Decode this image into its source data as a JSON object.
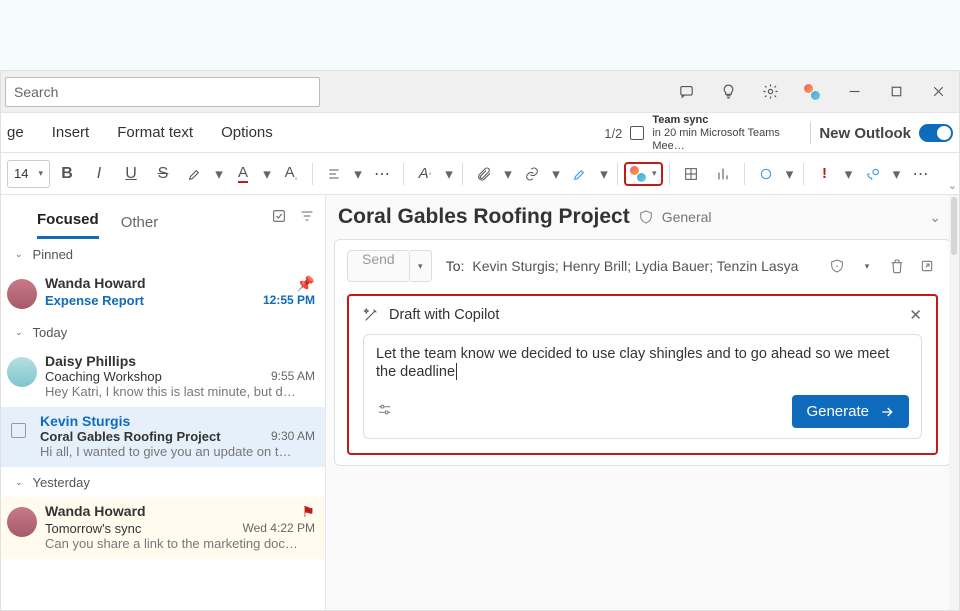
{
  "search": {
    "placeholder": "Search"
  },
  "ribbon": {
    "tabs": {
      "message": "ge",
      "insert": "Insert",
      "format": "Format text",
      "options": "Options"
    },
    "pager": "1/2",
    "meeting": {
      "title": "Team sync",
      "subtitle": "in 20 min Microsoft Teams Mee…"
    },
    "new_outlook": "New Outlook"
  },
  "toolbar": {
    "font_size": "14"
  },
  "inbox": {
    "tabs": {
      "focused": "Focused",
      "other": "Other"
    },
    "groups": {
      "pinned": "Pinned",
      "today": "Today",
      "yesterday": "Yesterday"
    },
    "m1": {
      "sender": "Wanda Howard",
      "subject": "Expense Report",
      "time": "12:55 PM"
    },
    "m2": {
      "sender": "Daisy Phillips",
      "subject": "Coaching Workshop",
      "time": "9:55 AM",
      "preview": "Hey Katri, I know this is last minute, but d…"
    },
    "m3": {
      "sender": "Kevin Sturgis",
      "subject": "Coral Gables Roofing Project",
      "time": "9:30 AM",
      "preview": "Hi all, I wanted to give you an update on t…"
    },
    "m4": {
      "sender": "Wanda Howard",
      "subject": "Tomorrow's sync",
      "time": "Wed 4:22 PM",
      "preview": "Can you share a link to the marketing doc…"
    }
  },
  "thread": {
    "title": "Coral Gables Roofing Project",
    "general": "General"
  },
  "compose": {
    "send": "Send",
    "to_label": "To:",
    "to_list": "Kevin Sturgis; Henry Brill; Lydia Bauer; Tenzin Lasya"
  },
  "copilot": {
    "title": "Draft with Copilot",
    "prompt": "Let the team know we decided to use clay shingles and to go ahead so we meet the deadline",
    "generate": "Generate"
  }
}
